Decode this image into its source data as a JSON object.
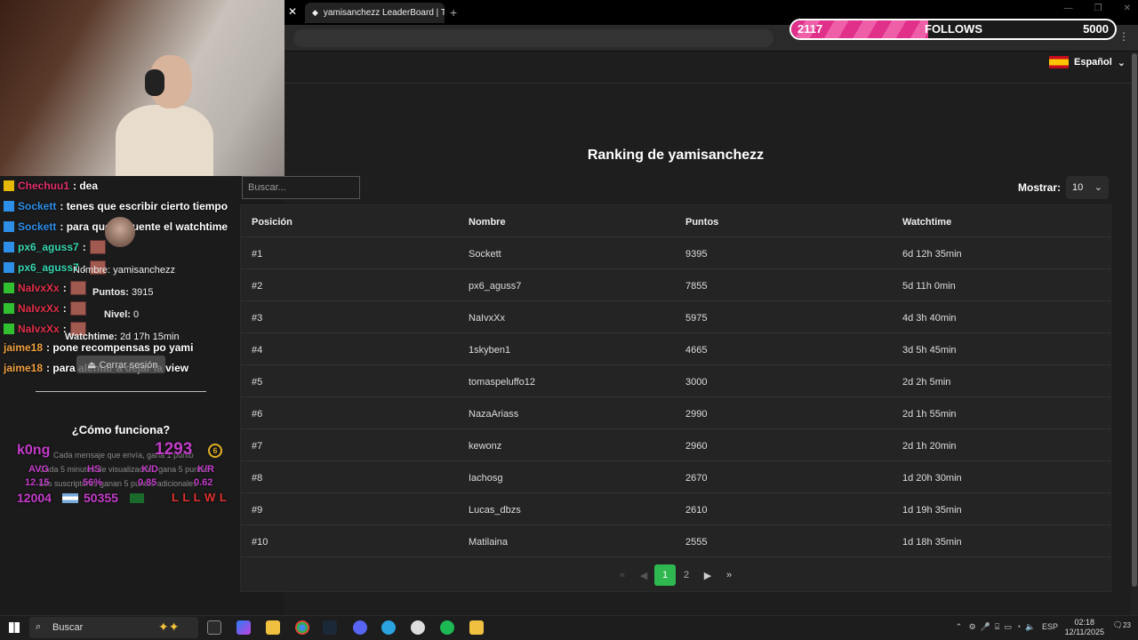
{
  "browser": {
    "tab_title": "yamisanchezz LeaderBoard | Th",
    "follow_goal": {
      "current": "2117",
      "label": "FOLLOWS",
      "goal": "5000",
      "progress": 0.4234
    }
  },
  "page": {
    "language": "Español",
    "title": "Ranking de yamisanchezz",
    "search_placeholder": "Buscar...",
    "show_label": "Mostrar:",
    "show_value": "10",
    "columns": [
      "Posición",
      "Nombre",
      "Puntos",
      "Watchtime"
    ],
    "rows": [
      {
        "pos": "#1",
        "name": "Sockett",
        "points": "9395",
        "watchtime": "6d 12h 35min"
      },
      {
        "pos": "#2",
        "name": "px6_aguss7",
        "points": "7855",
        "watchtime": "5d 11h 0min"
      },
      {
        "pos": "#3",
        "name": "NaIvxXx",
        "points": "5975",
        "watchtime": "4d 3h 40min"
      },
      {
        "pos": "#4",
        "name": "1skyben1",
        "points": "4665",
        "watchtime": "3d 5h 45min"
      },
      {
        "pos": "#5",
        "name": "tomaspeluffo12",
        "points": "3000",
        "watchtime": "2d 2h 5min"
      },
      {
        "pos": "#6",
        "name": "NazaAriass",
        "points": "2990",
        "watchtime": "2d 1h 55min"
      },
      {
        "pos": "#7",
        "name": "kewonz",
        "points": "2960",
        "watchtime": "2d 1h 20min"
      },
      {
        "pos": "#8",
        "name": "Iachosg",
        "points": "2670",
        "watchtime": "1d 20h 30min"
      },
      {
        "pos": "#9",
        "name": "Lucas_dbzs",
        "points": "2610",
        "watchtime": "1d 19h 35min"
      },
      {
        "pos": "#10",
        "name": "Matilaina",
        "points": "2555",
        "watchtime": "1d 18h 35min"
      }
    ],
    "pagination": {
      "pages": [
        "1",
        "2"
      ],
      "active": "1"
    }
  },
  "chat": [
    {
      "user": "Chechuu1",
      "color": "#e0306a",
      "message": ": dea"
    },
    {
      "user": "Sockett",
      "color": "#2e8fe8",
      "message": ": tenes que escribir cierto tiempo"
    },
    {
      "user": "Sockett",
      "color": "#2e8fe8",
      "message": ": para que te cuente el watchtime"
    },
    {
      "user": "px6_aguss7",
      "color": "#38d6b0",
      "message": ":"
    },
    {
      "user": "px6_aguss7",
      "color": "#38d6b0",
      "message": ":"
    },
    {
      "user": "NaIvxXx",
      "color": "#e0304a",
      "message": ":"
    },
    {
      "user": "NaIvxXx",
      "color": "#e0304a",
      "message": ":"
    },
    {
      "user": "NaIvxXx",
      "color": "#e0304a",
      "message": ":"
    },
    {
      "user": "jaime18",
      "color": "#f0a040",
      "message": ": pone recompensas po yami"
    },
    {
      "user": "jaime18",
      "color": "#f0a040",
      "message": ": para alentar a dejar la view"
    }
  ],
  "profile": {
    "name_label": "Nombre:",
    "name_value": "yamisanchezz",
    "points_label": "Puntos:",
    "points_value": "3915",
    "level_label": "Nivel:",
    "level_value": "0",
    "watch_label": "Watchtime:",
    "watch_value": "2d 17h 15min",
    "logout": "Cerrar sesión"
  },
  "how": {
    "title": "¿Cómo funciona?",
    "line1": "Cada mensaje que envía, gana 1 punto",
    "line2": "Cada 5 minutos de visualización, gana 5 puntos",
    "line3": "Los suscriptores ganan 5 puntos adicionales"
  },
  "stats": {
    "player": "k0ng",
    "rating": "1293",
    "level": "6",
    "avg_label": "AVG",
    "hs_label": "HS",
    "kd_label": "K/D",
    "kr_label": "K/R",
    "avg": "12.15",
    "hs": "56%",
    "kd": "0.85",
    "kr": "0.62",
    "elo": "12004",
    "points": "50355",
    "streak": "L L L W L"
  },
  "taskbar": {
    "search": "Buscar",
    "lang": "ESP",
    "time": "02:18",
    "date": "12/11/2025",
    "notif": "23"
  }
}
